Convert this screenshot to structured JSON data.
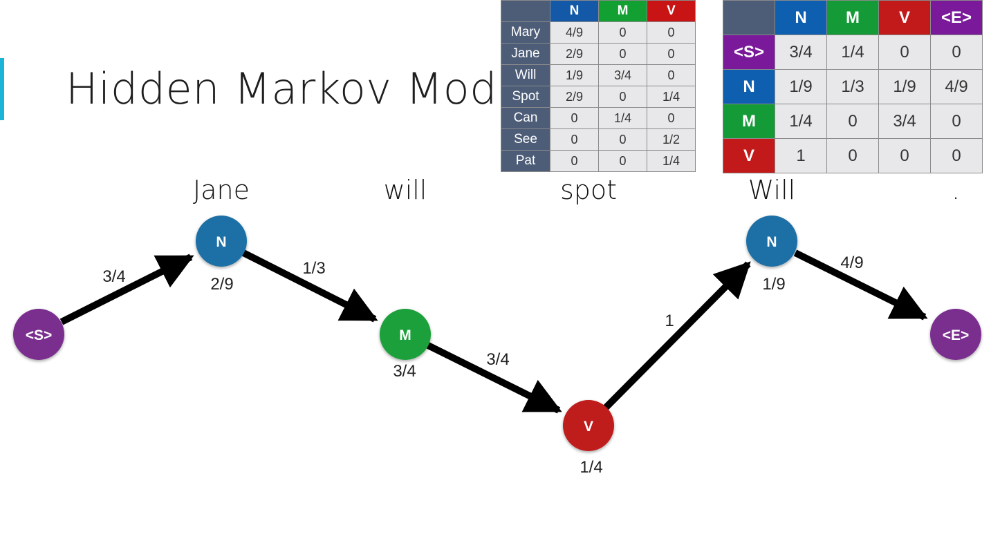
{
  "slide": {
    "title": "Hidden Markov Model"
  },
  "colors": {
    "N": "#1a6fa6",
    "M": "#1ea03a",
    "V": "#bf1e1e",
    "S": "#7a2e8e",
    "E": "#7a2e8e",
    "header_blue_emit": "#1459a8",
    "header_green_emit": "#13a032",
    "header_red_emit": "#c81414",
    "header_blue": "#0f5fb0",
    "header_green": "#149a36",
    "header_red": "#c21a1a",
    "header_purple": "#7a1a9a",
    "accent": "#1bb4d8"
  },
  "emission_table": {
    "columns": [
      "N",
      "M",
      "V"
    ],
    "rows": [
      {
        "word": "Mary",
        "values": [
          "4/9",
          "0",
          "0"
        ]
      },
      {
        "word": "Jane",
        "values": [
          "2/9",
          "0",
          "0"
        ]
      },
      {
        "word": "Will",
        "values": [
          "1/9",
          "3/4",
          "0"
        ]
      },
      {
        "word": "Spot",
        "values": [
          "2/9",
          "0",
          "1/4"
        ]
      },
      {
        "word": "Can",
        "values": [
          "0",
          "1/4",
          "0"
        ]
      },
      {
        "word": "See",
        "values": [
          "0",
          "0",
          "1/2"
        ]
      },
      {
        "word": "Pat",
        "values": [
          "0",
          "0",
          "1/4"
        ]
      }
    ]
  },
  "transition_table": {
    "columns": [
      "N",
      "M",
      "V",
      "<E>"
    ],
    "rows": [
      {
        "state": "<S>",
        "values": [
          "3/4",
          "1/4",
          "0",
          "0"
        ]
      },
      {
        "state": "N",
        "values": [
          "1/9",
          "1/3",
          "1/9",
          "4/9"
        ]
      },
      {
        "state": "M",
        "values": [
          "1/4",
          "0",
          "3/4",
          "0"
        ]
      },
      {
        "state": "V",
        "values": [
          "1",
          "0",
          "0",
          "0"
        ]
      }
    ]
  },
  "diagram": {
    "words": [
      "Jane",
      "will",
      "spot",
      "Will",
      "."
    ],
    "nodes": [
      {
        "id": "start",
        "label": "<S>"
      },
      {
        "id": "n1",
        "label": "N",
        "emission": "2/9"
      },
      {
        "id": "m1",
        "label": "M",
        "emission": "3/4"
      },
      {
        "id": "v1",
        "label": "V",
        "emission": "1/4"
      },
      {
        "id": "n2",
        "label": "N",
        "emission": "1/9"
      },
      {
        "id": "end",
        "label": "<E>"
      }
    ],
    "edges": [
      {
        "from": "start",
        "to": "n1",
        "prob": "3/4"
      },
      {
        "from": "n1",
        "to": "m1",
        "prob": "1/3"
      },
      {
        "from": "m1",
        "to": "v1",
        "prob": "3/4"
      },
      {
        "from": "v1",
        "to": "n2",
        "prob": "1"
      },
      {
        "from": "n2",
        "to": "end",
        "prob": "4/9"
      }
    ]
  }
}
